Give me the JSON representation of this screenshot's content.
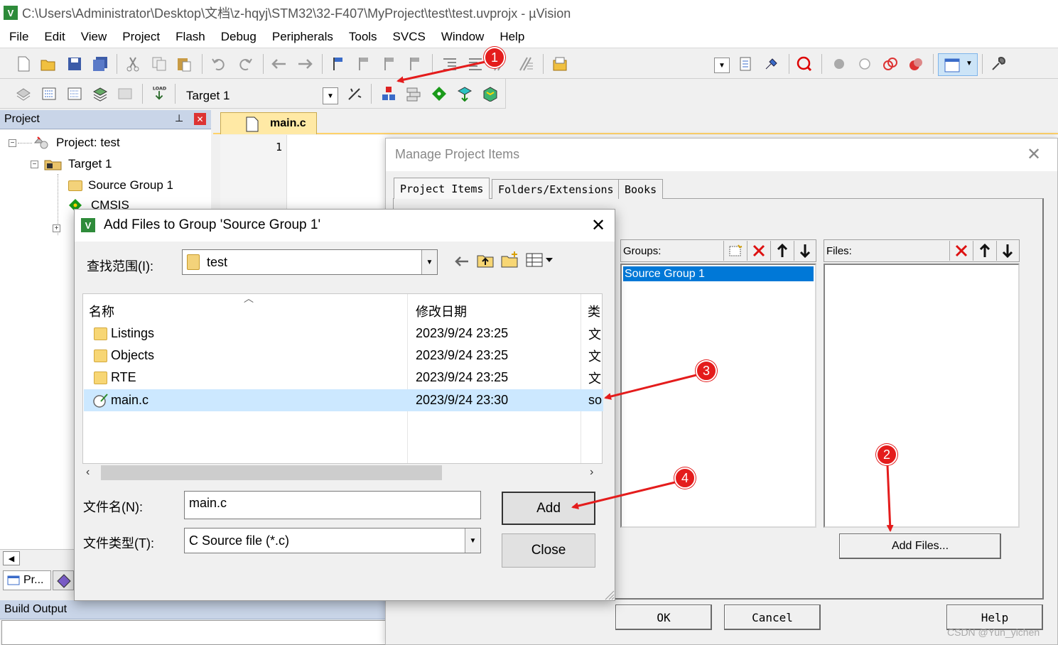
{
  "window": {
    "title": "C:\\Users\\Administrator\\Desktop\\文档\\z-hqyj\\STM32\\32-F407\\MyProject\\test\\test.uvprojx - µVision"
  },
  "menu": [
    "File",
    "Edit",
    "View",
    "Project",
    "Flash",
    "Debug",
    "Peripherals",
    "Tools",
    "SVCS",
    "Window",
    "Help"
  ],
  "build_toolbar": {
    "target": "Target 1"
  },
  "project_panel": {
    "title": "Project",
    "tree": {
      "root": "Project: test",
      "target": "Target 1",
      "group": "Source Group 1",
      "cmsis": "CMSIS"
    },
    "bottom_tab": "Pr..."
  },
  "editor": {
    "tab": "main.c",
    "line_number": "1"
  },
  "build_output": {
    "title": "Build Output"
  },
  "manage_dialog": {
    "title": "Manage Project Items",
    "tabs": [
      "Project Items",
      "Folders/Extensions",
      "Books"
    ],
    "groups_label": "Groups:",
    "files_label": "Files:",
    "groups": [
      "Source Group 1"
    ],
    "add_files_button": "Add Files...",
    "ok": "OK",
    "cancel": "Cancel",
    "help": "Help"
  },
  "add_dialog": {
    "title": "Add Files to Group 'Source Group 1'",
    "look_in_label": "查找范围(I):",
    "look_in_value": "test",
    "columns": {
      "name": "名称",
      "date": "修改日期",
      "type": "类"
    },
    "files": [
      {
        "name": "Listings",
        "date": "2023/9/24 23:25",
        "type": "文",
        "kind": "folder"
      },
      {
        "name": "Objects",
        "date": "2023/9/24 23:25",
        "type": "文",
        "kind": "folder"
      },
      {
        "name": "RTE",
        "date": "2023/9/24 23:25",
        "type": "文",
        "kind": "folder"
      },
      {
        "name": "main.c",
        "date": "2023/9/24 23:30",
        "type": "so",
        "kind": "file"
      }
    ],
    "filename_label": "文件名(N):",
    "filename_value": "main.c",
    "filetype_label": "文件类型(T):",
    "filetype_value": "C Source file (*.c)",
    "add_button": "Add",
    "close_button": "Close"
  },
  "annotations": [
    "1",
    "2",
    "3",
    "4"
  ],
  "watermark": "CSDN @Yun_yichen",
  "colors": {
    "accent_red": "#e41c1c",
    "selection_blue": "#0078d7",
    "row_highlight": "#cce8ff"
  }
}
